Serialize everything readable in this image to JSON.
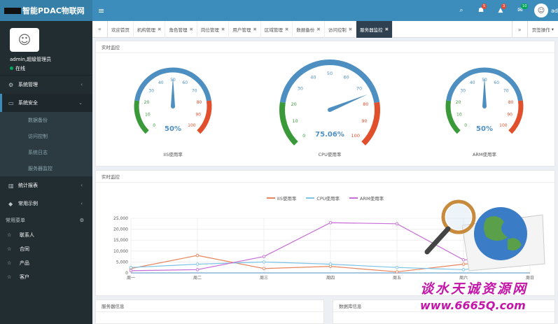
{
  "header": {
    "title": "智能PDAC物联网",
    "menu_toggle_icon": "menu-icon",
    "icons": [
      {
        "name": "search-icon",
        "glyph": "⌕",
        "badge": ""
      },
      {
        "name": "user-group-icon",
        "glyph": "☗",
        "badge": "5"
      },
      {
        "name": "bell-icon",
        "glyph": "🔔",
        "badge": "3"
      },
      {
        "name": "mail-icon",
        "glyph": "✉",
        "badge": "10"
      }
    ],
    "user_short": "ad"
  },
  "sidebar": {
    "user_name": "admin,超级管理员",
    "user_status": "在线",
    "menu": [
      {
        "label": "系统管理",
        "icon": "gears-icon"
      },
      {
        "label": "系统安全",
        "icon": "desktop-icon"
      }
    ],
    "submenu": [
      "数据备份",
      "访问控制",
      "系统日志",
      "服务器监控"
    ],
    "menu2": [
      {
        "label": "统计报表",
        "icon": "bar-chart-icon"
      },
      {
        "label": "常用示例",
        "icon": "tag-icon"
      }
    ],
    "quick_header": "常用菜单",
    "quick": [
      "联系人",
      "合同",
      "产品",
      "客户"
    ]
  },
  "tabs": {
    "items": [
      "欢迎首页",
      "机构管理",
      "角色管理",
      "岗位管理",
      "用户管理",
      "区域管理",
      "数据备份",
      "访问控制",
      "服务器监控"
    ],
    "active_index": 8,
    "page_ops": "页签操作"
  },
  "monitor": {
    "title": "实时监控",
    "gauges": [
      {
        "label": "IIS使用率",
        "value": 50,
        "display": "50%"
      },
      {
        "label": "CPU使用率",
        "value": 75.06,
        "display": "75.06%"
      },
      {
        "label": "ARM使用率",
        "value": 50,
        "display": "50%"
      }
    ]
  },
  "chart_panel": {
    "title": "实时监控"
  },
  "chart_data": {
    "type": "line",
    "categories": [
      "周一",
      "周二",
      "周三",
      "周四",
      "周五",
      "周六",
      "周日"
    ],
    "series": [
      {
        "name": "IIS使用率",
        "values": [
          2000,
          8000,
          2000,
          3000,
          500,
          4000,
          6000
        ],
        "color": "#e8845b"
      },
      {
        "name": "CPU使用率",
        "values": [
          2500,
          4000,
          5000,
          4000,
          2500,
          1500,
          5000
        ],
        "color": "#7dc3e8"
      },
      {
        "name": "ARM使用率",
        "values": [
          1000,
          1500,
          7500,
          23000,
          22500,
          6000,
          5000
        ],
        "color": "#c86cd8"
      }
    ],
    "y_ticks": [
      "0",
      "5,000",
      "10,000",
      "15,000",
      "20,000",
      "25,000"
    ],
    "ylim": [
      0,
      25000
    ],
    "legend": "top-center"
  },
  "bottom": {
    "left_title": "服务器信息",
    "right_title": "数据库信息"
  },
  "watermark": {
    "line1": "谈水天诚资源网",
    "line2": "www.6665Q.com"
  }
}
